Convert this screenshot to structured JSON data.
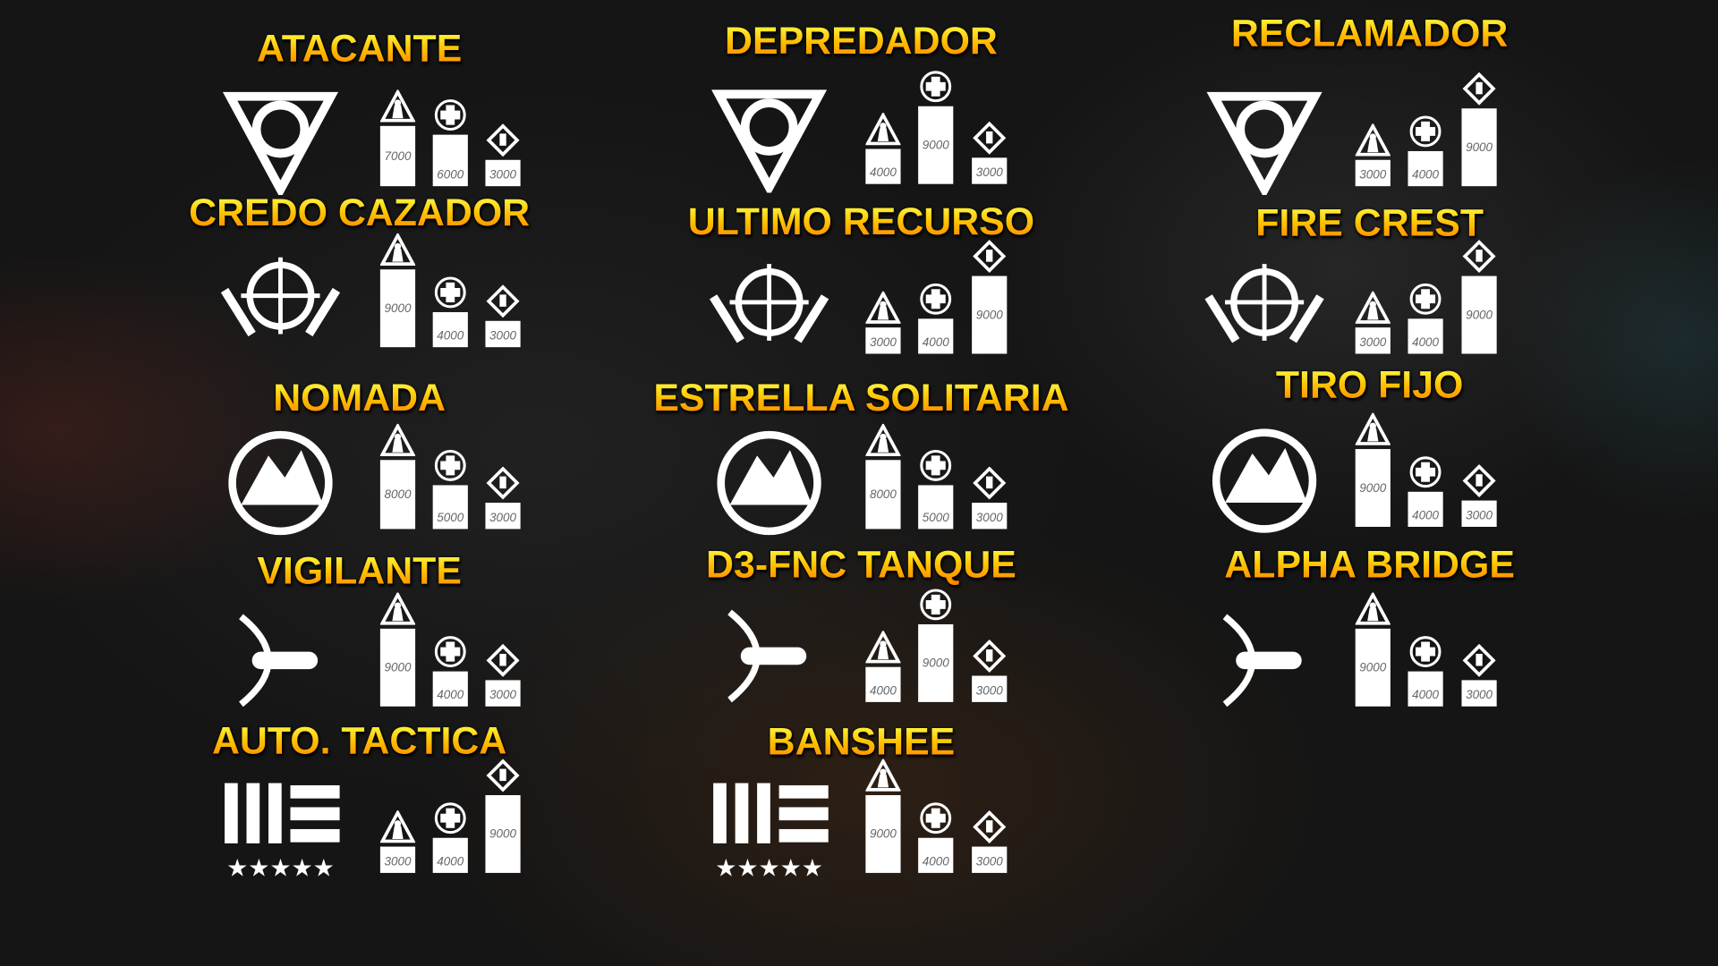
{
  "stat_icons": [
    "attack-triangle-icon",
    "health-cross-icon",
    "armor-diamond-icon"
  ],
  "colors": {
    "title_top": "#fff23a",
    "title_bottom": "#ff7a00",
    "bar": "#ffffff",
    "background": "#151515"
  },
  "columns": [
    {
      "items": [
        {
          "name": "ATACANTE",
          "emblem": "revolver-cylinder-emblem",
          "stats": [
            7000,
            6000,
            3000
          ]
        },
        {
          "name": "CREDO CAZADOR",
          "emblem": "crosshair-wings-emblem",
          "stats": [
            9000,
            4000,
            3000
          ]
        },
        {
          "name": "NOMADA",
          "emblem": "mountain-emblem",
          "stats": [
            8000,
            5000,
            3000
          ]
        },
        {
          "name": "VIGILANTE",
          "emblem": "bow-bullet-emblem",
          "stats": [
            9000,
            4000,
            3000
          ]
        },
        {
          "name": "AUTO. TACTICA",
          "emblem": "stripes-stars-emblem",
          "stats": [
            3000,
            4000,
            9000
          ]
        }
      ]
    },
    {
      "items": [
        {
          "name": "DEPREDADOR",
          "emblem": "tiger-emblem",
          "stats": [
            4000,
            9000,
            3000
          ]
        },
        {
          "name": "ULTIMO RECURSO",
          "emblem": "hexagon-shield-emblem",
          "stats": [
            3000,
            4000,
            9000
          ]
        },
        {
          "name": "ESTRELLA SOLITARIA",
          "emblem": "star-t-emblem",
          "stats": [
            8000,
            5000,
            3000
          ]
        },
        {
          "name": "D3-FNC TANQUE",
          "emblem": "sword-shield-emblem",
          "stats": [
            4000,
            9000,
            3000
          ]
        },
        {
          "name": "BANSHEE",
          "emblem": "jet-emblem",
          "stats": [
            9000,
            4000,
            3000
          ]
        }
      ]
    },
    {
      "items": [
        {
          "name": "RECLAMADOR",
          "emblem": "reclaimer-d-emblem",
          "stats": [
            3000,
            4000,
            9000
          ]
        },
        {
          "name": "FIRE CREST",
          "emblem": "flame-crest-emblem",
          "stats": [
            3000,
            4000,
            9000
          ]
        },
        {
          "name": "TIRO FIJO",
          "emblem": "eye-emblem",
          "stats": [
            9000,
            4000,
            3000
          ]
        },
        {
          "name": "ALPHA BRIDGE",
          "emblem": "letter-a-emblem",
          "stats": [
            9000,
            4000,
            3000
          ]
        }
      ]
    }
  ]
}
